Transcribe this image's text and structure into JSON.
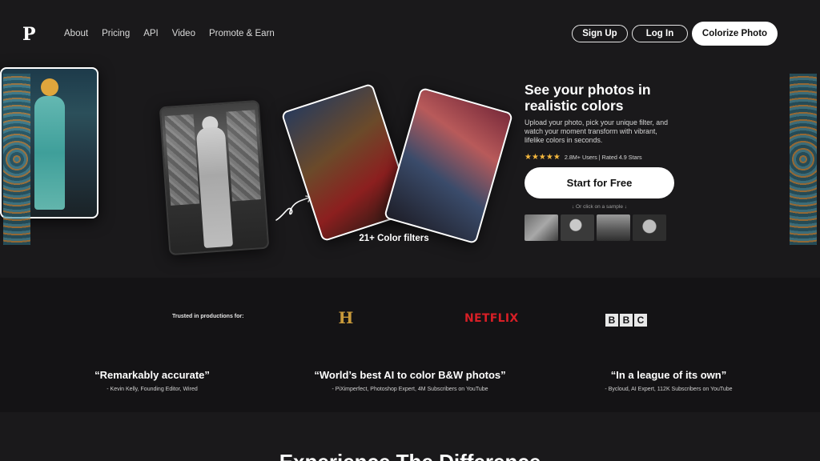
{
  "nav": {
    "logo": "P",
    "links": [
      "About",
      "Pricing",
      "API",
      "Video",
      "Promote & Earn"
    ],
    "signup": "Sign Up",
    "login": "Log In",
    "colorize": "Colorize Photo"
  },
  "hero": {
    "title": "See your photos in realistic colors",
    "description": "Upload your photo, pick your unique filter, and watch your moment transform with vibrant, lifelike colors in seconds.",
    "stars": "★★★★★",
    "rating_text": "2.8M+ Users | Rated 4.9 Stars",
    "cta": "Start for Free",
    "sample_hint": "↓ Or click on a sample ↓",
    "filters_label": "21+ Color filters"
  },
  "trusted": {
    "label": "Trusted in productions for:",
    "logos": {
      "history": "H",
      "netflix": "NETFLIX",
      "bbc": [
        "B",
        "B",
        "C"
      ]
    }
  },
  "quotes": [
    {
      "text": "“Remarkably accurate”",
      "author": "- Kevin Kelly, Founding Editor, Wired"
    },
    {
      "text": "“World’s best AI to color B&W photos”",
      "author": "- PiXimperfect, Photoshop Expert, 4M Subscribers on YouTube"
    },
    {
      "text": "“In a league of its own”",
      "author": "- Bycloud, AI Expert, 112K Subscribers on YouTube"
    }
  ],
  "section_title": "Experience The Difference",
  "colors": {
    "background": "#1a191b",
    "band": "#141315",
    "star": "#f4b73d",
    "netflix": "#d81f26",
    "history": "#c99a3a"
  }
}
